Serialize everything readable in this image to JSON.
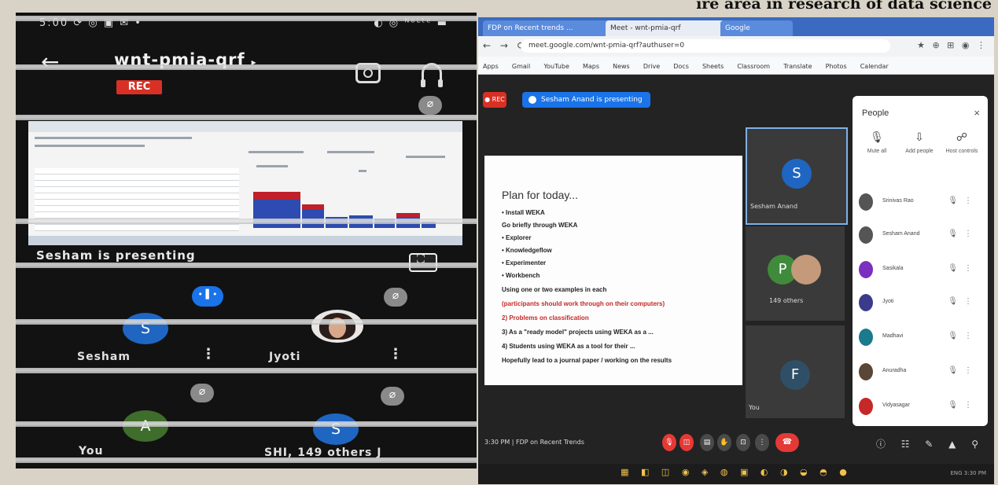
{
  "heading": "ire area in research of data science",
  "phone": {
    "status_left": "5:00  ⟳ ◎ ▣ ✉ •",
    "status_right": "◐ ◎ ᴺᵒᴸᵗᵉ ▬",
    "meeting_code": "wnt-pmia-qrf",
    "rec_label": "REC",
    "presenting_label": "Sesham is presenting",
    "tiles": [
      {
        "name": "Sesham",
        "initial": "S",
        "color": "#1f66c2"
      },
      {
        "name": "Jyoti",
        "initial": "",
        "color": ""
      },
      {
        "name": "You",
        "initial": "A",
        "color": "#3f6d2b"
      },
      {
        "name": "SHI, 149 others",
        "initial": "S",
        "color": "#1f66c2"
      }
    ],
    "tile_suffix": "J"
  },
  "laptop": {
    "tabs": [
      "FDP on Recent trends ...",
      "Meet - wnt-pmia-qrf",
      "Google"
    ],
    "url": "meet.google.com/wnt-pmia-qrf?authuser=0",
    "bookmarks": [
      "Apps",
      "Gmail",
      "YouTube",
      "Maps",
      "News",
      "Drive",
      "Docs",
      "Sheets",
      "Classroom",
      "Translate",
      "Photos",
      "Calendar"
    ],
    "presenting_chip": "Sesham Anand is presenting",
    "slide": {
      "title": "Plan for today...",
      "lines": [
        {
          "text": "• Install WEKA",
          "red": false
        },
        {
          "text": "Go briefly through WEKA",
          "red": false
        },
        {
          "text": "•   Explorer",
          "red": false
        },
        {
          "text": "•   Knowledgeflow",
          "red": false
        },
        {
          "text": "•   Experimenter",
          "red": false
        },
        {
          "text": "•   Workbench",
          "red": false
        },
        {
          "text": "Using one or two examples in each",
          "red": false
        },
        {
          "text": "(participants should work through on their computers)",
          "red": true
        },
        {
          "text": "2) Problems on classification",
          "red": true
        },
        {
          "text": "3) As a \"ready model\" projects using WEKA as a ...",
          "red": false
        },
        {
          "text": "4) Students using WEKA as a tool for their ...",
          "red": false
        },
        {
          "text": "Hopefully lead to a journal paper / working on the results",
          "red": false
        }
      ]
    },
    "thumbs": [
      {
        "name": "Sesham Anand",
        "initial": "S",
        "color": "#1f66c2"
      },
      {
        "name": "149 others",
        "initial": "P",
        "color": "#3f8b3b"
      },
      {
        "name": "You",
        "initial": "F",
        "color": "#2f4f66"
      }
    ],
    "people": {
      "title": "People",
      "close": "×",
      "actions": [
        {
          "icon": "🎙",
          "label": "Mute all"
        },
        {
          "icon": "⇩",
          "label": "Add people"
        },
        {
          "icon": "☍",
          "label": "Host controls"
        }
      ],
      "list": [
        {
          "name": "Srinivas Rao",
          "color": "#555"
        },
        {
          "name": "Sesham Anand",
          "color": "#555"
        },
        {
          "name": "Sasikala",
          "color": "#7b2fbf"
        },
        {
          "name": "Jyoti",
          "color": "#3b3b8b"
        },
        {
          "name": "Madhavi",
          "color": "#1b7a8c"
        },
        {
          "name": "Anuradha",
          "color": "#5a4636"
        },
        {
          "name": "Vidyasagar",
          "color": "#c62828"
        }
      ]
    },
    "meeting_info": "3:30 PM  |  FDP on Recent Trends",
    "tray": "ENG  3:30 PM"
  }
}
